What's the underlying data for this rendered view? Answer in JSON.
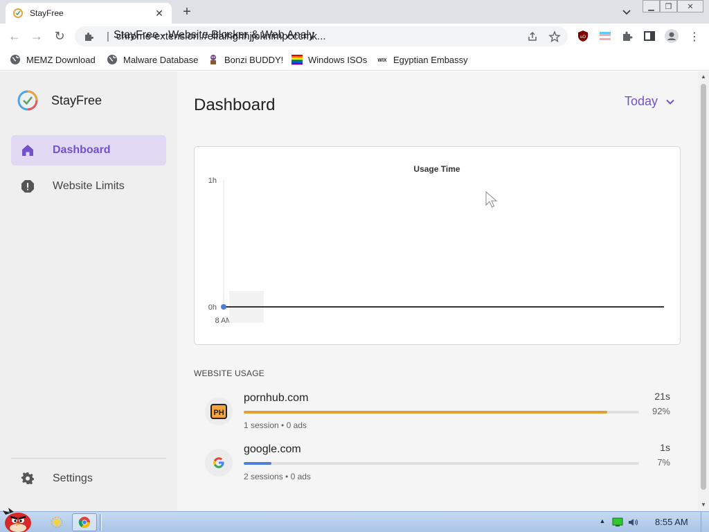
{
  "browser": {
    "tab_title": "StayFree",
    "omnibox_site": "StayFree - Website Blocker & Web Analy",
    "omnibox_url": "chrome-extension://elfaihghhjjoknimpcccmk...",
    "bookmarks": [
      {
        "label": "MEMZ Download",
        "icon": "globe-icon"
      },
      {
        "label": "Malware Database",
        "icon": "globe-icon"
      },
      {
        "label": "Bonzi BUDDY!",
        "icon": "bonzi-icon"
      },
      {
        "label": "Windows ISOs",
        "icon": "rainbow-flag-icon"
      },
      {
        "label": "Egyptian Embassy",
        "icon": "wix-icon"
      }
    ]
  },
  "app": {
    "brand": "StayFree",
    "nav": [
      {
        "label": "Dashboard",
        "icon": "home-icon",
        "active": true
      },
      {
        "label": "Website Limits",
        "icon": "alert-icon",
        "active": false
      }
    ],
    "settings_label": "Settings",
    "page_title": "Dashboard",
    "range_label": "Today",
    "accent_color": "#7352c7",
    "section_label": "WEBSITE USAGE",
    "sites": [
      {
        "name": "pornhub.com",
        "meta": "1 session  •  0 ads",
        "time": "21s",
        "percent": "92%",
        "share": 0.92,
        "bar_color": "#e0a032",
        "icon": "ph-icon"
      },
      {
        "name": "google.com",
        "meta": "2 sessions  •  0 ads",
        "time": "1s",
        "percent": "7%",
        "share": 0.07,
        "bar_color": "#4f7fd6",
        "icon": "google-icon"
      }
    ]
  },
  "chart_data": {
    "type": "line",
    "title": "Usage Time",
    "y_ticks": [
      "1h",
      "0h"
    ],
    "x_ticks": [
      "8 AM"
    ],
    "x": [
      "8 AM"
    ],
    "series": [
      {
        "values": [
          0
        ]
      }
    ],
    "ylim": [
      0,
      1
    ]
  },
  "taskbar": {
    "clock": "8:55 AM"
  }
}
